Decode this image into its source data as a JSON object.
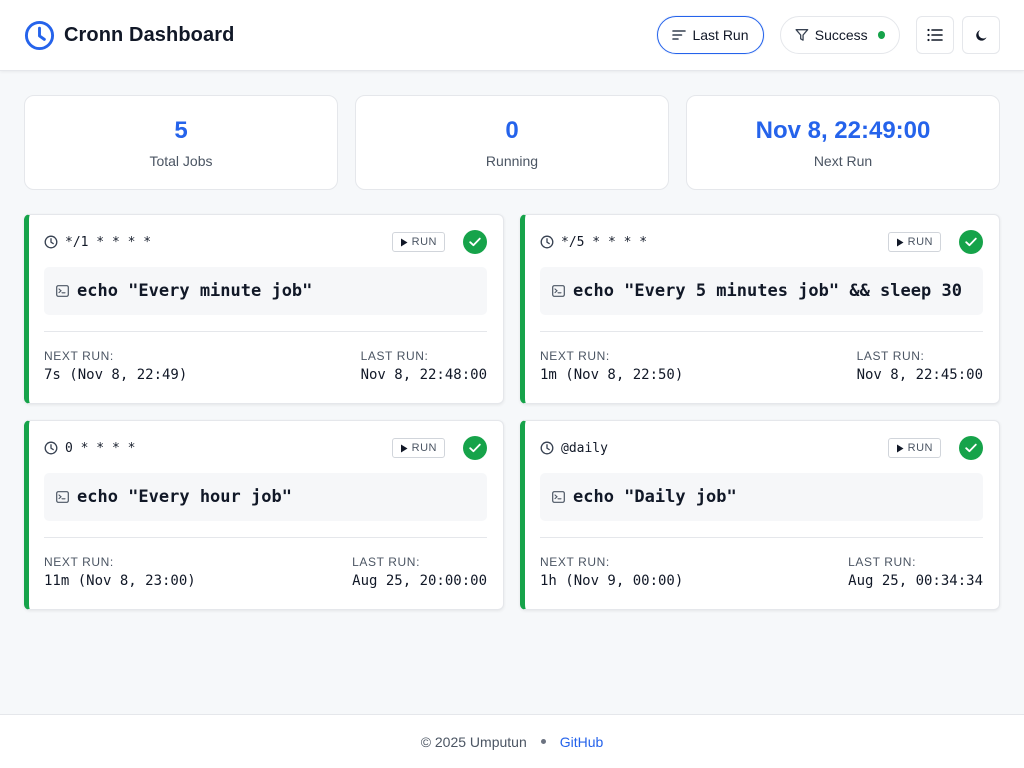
{
  "app": {
    "title": "Cronn Dashboard",
    "accent": "#2563eb",
    "success": "#16a34a"
  },
  "header": {
    "sort_label": "Last Run",
    "filter_label": "Success",
    "icons": [
      "clock-icon",
      "sort-lines-icon",
      "funnel-icon",
      "list-icon",
      "moon-icon"
    ]
  },
  "stats": [
    {
      "value": "5",
      "label": "Total Jobs"
    },
    {
      "value": "0",
      "label": "Running"
    },
    {
      "value": "Nov 8, 22:49:00",
      "label": "Next Run"
    }
  ],
  "jobs_common": {
    "run_label": "RUN",
    "next_run_label": "NEXT RUN:",
    "last_run_label": "LAST RUN:"
  },
  "jobs": [
    {
      "schedule": "*/1 * * * *",
      "command": "echo \"Every minute job\"",
      "next_run": "7s (Nov 8, 22:49)",
      "last_run": "Nov 8, 22:48:00"
    },
    {
      "schedule": "*/5 * * * *",
      "command": "echo \"Every 5 minutes job\" && sleep 30",
      "next_run": "1m (Nov 8, 22:50)",
      "last_run": "Nov 8, 22:45:00"
    },
    {
      "schedule": "0 * * * *",
      "command": "echo \"Every hour job\"",
      "next_run": "11m (Nov 8, 23:00)",
      "last_run": "Aug 25, 20:00:00"
    },
    {
      "schedule": "@daily",
      "command": "echo \"Daily job\"",
      "next_run": "1h (Nov 9, 00:00)",
      "last_run": "Aug 25, 00:34:34"
    }
  ],
  "footer": {
    "copyright": "© 2025 Umputun",
    "link_label": "GitHub"
  }
}
